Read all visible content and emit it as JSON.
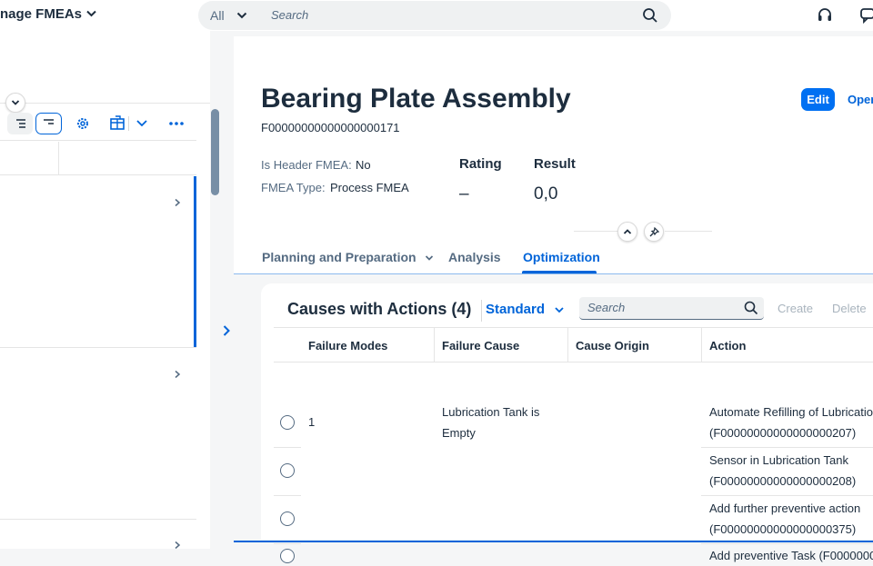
{
  "shell": {
    "app_title": "nage FMEAs",
    "search_scope": "All",
    "search_placeholder": "Search"
  },
  "colors": {
    "accent": "#0064d9",
    "edit_button": "#0070f2",
    "text": "#1d2d3e",
    "muted": "#556b82"
  },
  "header": {
    "title": "Bearing Plate Assembly",
    "id": "F00000000000000000171",
    "edit_label": "Edit",
    "open_label": "Oper",
    "attributes": [
      {
        "label": "Is Header FMEA:",
        "value": "No"
      },
      {
        "label": "FMEA Type:",
        "value": "Process FMEA"
      }
    ],
    "kpis": [
      {
        "label": "Rating",
        "value": "–"
      },
      {
        "label": "Result",
        "value": "0,0"
      }
    ]
  },
  "tabs": [
    {
      "label": "Planning and Preparation",
      "has_menu": true
    },
    {
      "label": "Analysis"
    },
    {
      "label": "Optimization",
      "active": true
    }
  ],
  "causes_table": {
    "title": "Causes with Actions (4)",
    "variant": "Standard",
    "search_placeholder": "Search",
    "create_label": "Create",
    "delete_label": "Delete",
    "columns": [
      "Failure Modes",
      "Failure Cause",
      "Cause Origin",
      "Action"
    ],
    "rows": [
      {
        "failure_mode": "1",
        "cause_line1": "Lubrication Tank is",
        "cause_line2": "Empty",
        "origin": "",
        "action_line1": "Automate Refilling of Lubricatio",
        "action_line2": "(F00000000000000000207)"
      },
      {
        "failure_mode": "",
        "cause_line1": "",
        "cause_line2": "",
        "origin": "",
        "action_line1": "Sensor in Lubrication Tank",
        "action_line2": "(F00000000000000000208)"
      },
      {
        "failure_mode": "",
        "cause_line1": "",
        "cause_line2": "",
        "origin": "",
        "action_line1": "Add further preventive action",
        "action_line2": "(F00000000000000000375)"
      },
      {
        "failure_mode": "",
        "cause_line1": "",
        "cause_line2": "",
        "origin": "",
        "action_line1": "Add preventive Task (F0000000",
        "action_line2": ""
      }
    ]
  }
}
